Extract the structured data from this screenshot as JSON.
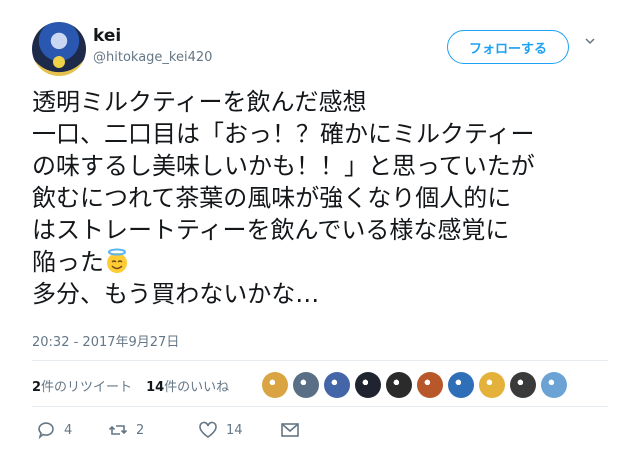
{
  "header": {
    "display_name": "kei",
    "handle": "@hitokage_kei420",
    "follow_label": "フォローする"
  },
  "tweet": {
    "lines": [
      "透明ミルクティーを飲んだ感想",
      "一口、二口目は「おっ！？確かにミルクティー",
      "の味するし美味しいかも！！」と思っていたが",
      "飲むにつれて茶葉の風味が強くなり個人的に",
      "はストレートティーを飲んでいる様な感覚に",
      "陥った",
      "多分、もう買わないかな…"
    ],
    "emoji": "smiling-face-with-halo"
  },
  "timestamp": "20:32 - 2017年9月27日",
  "stats": {
    "retweets_count": "2",
    "retweets_label": "件のリツイート",
    "likes_count": "14",
    "likes_label": "件のいいね"
  },
  "liker_avatars": [
    "#d9a441",
    "#5a6f86",
    "#4466a8",
    "#1f2430",
    "#2b2b2b",
    "#b8582a",
    "#2f6fb8",
    "#e4b23a",
    "#3a3a3a",
    "#6ba3d4"
  ],
  "actions": {
    "reply_count": "4",
    "retweet_count": "2",
    "like_count": "14"
  },
  "colors": {
    "accent": "#1da1f2",
    "muted": "#657786",
    "text": "#14171a"
  }
}
